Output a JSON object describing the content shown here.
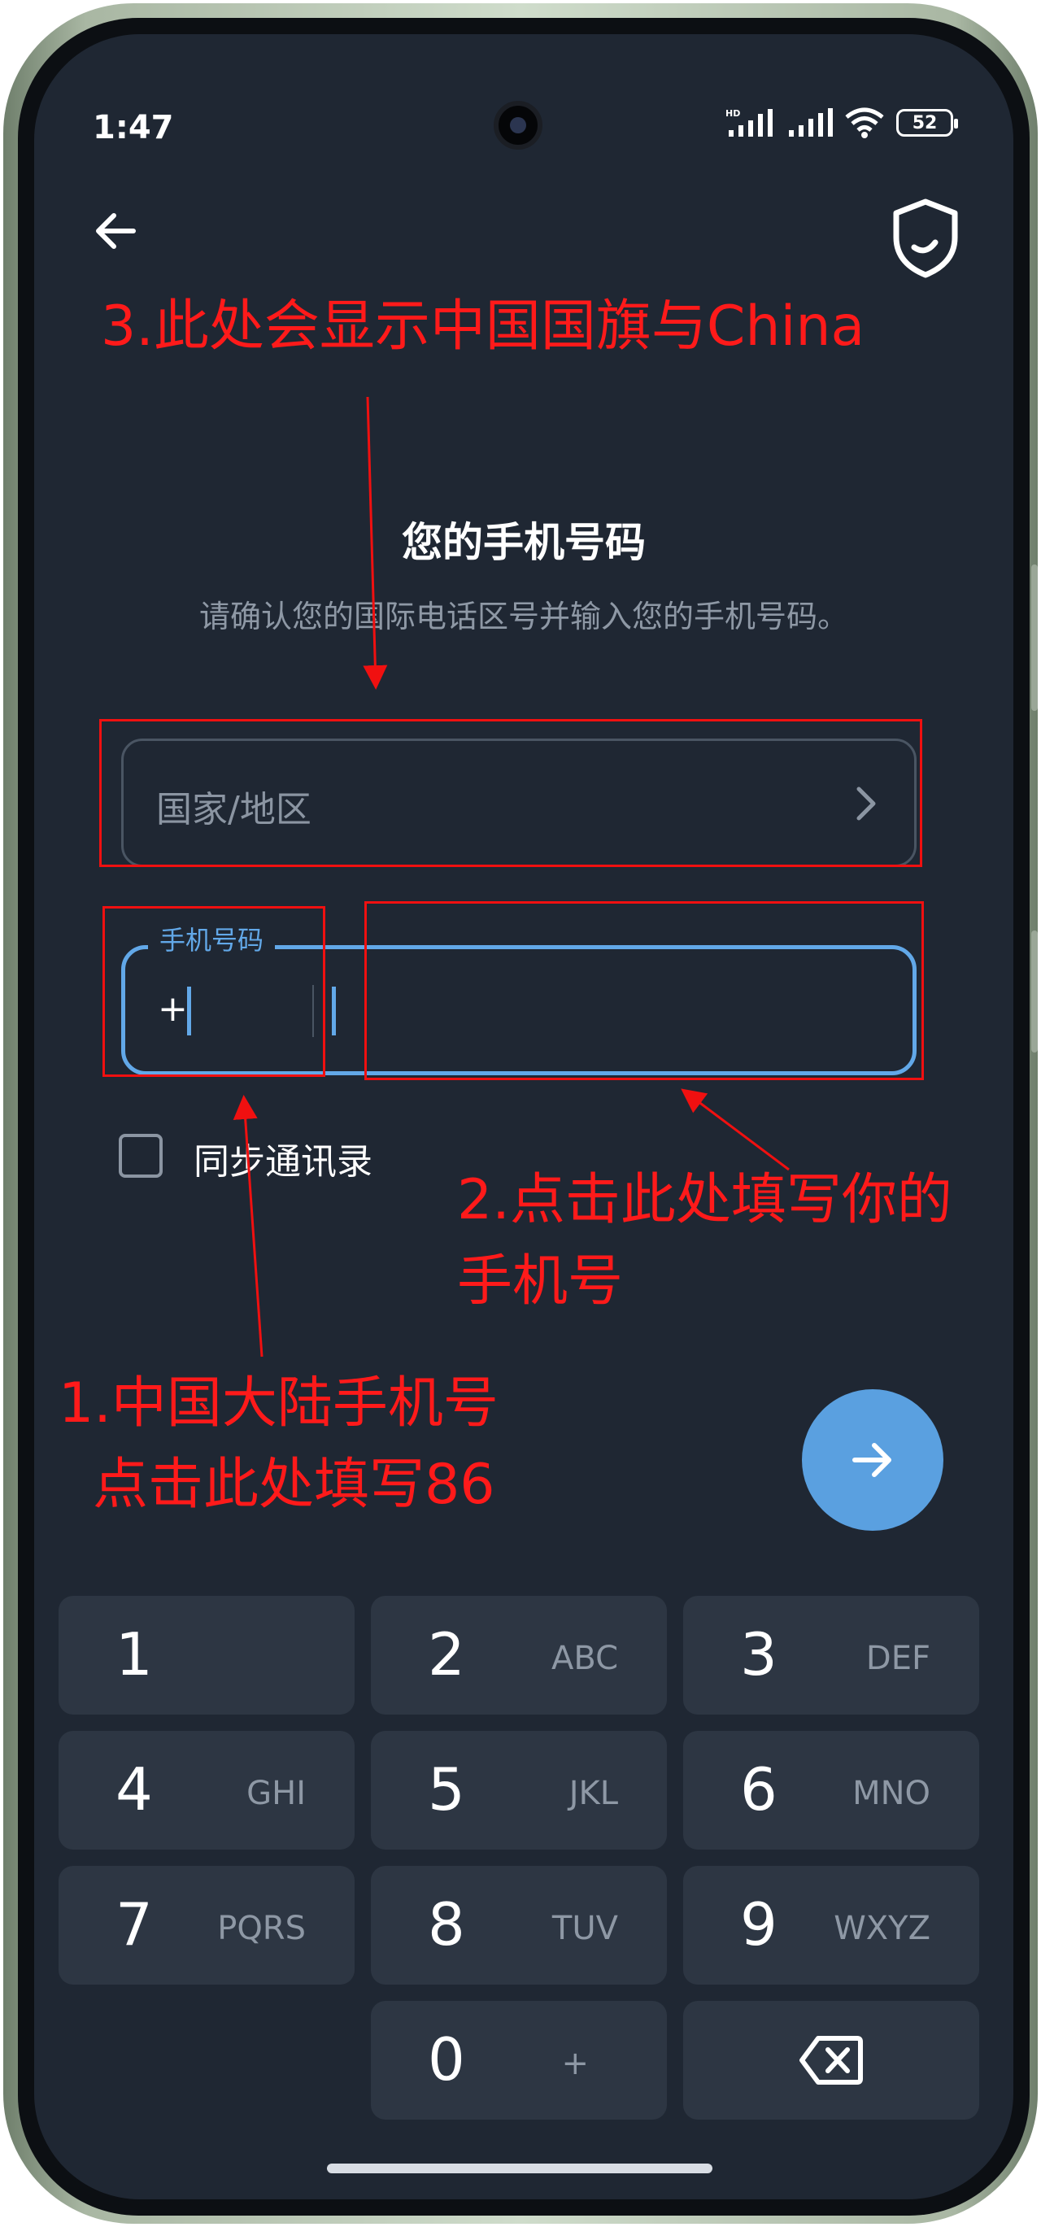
{
  "status_bar": {
    "time": "1:47",
    "network_label": "HD",
    "battery": "52"
  },
  "header": {
    "back_icon": "arrow-left-icon",
    "shield_icon": "shield-icon"
  },
  "main": {
    "title": "您的手机号码",
    "subtitle": "请确认您的国际电话区号并输入您的手机号码。",
    "country_field": {
      "placeholder": "国家/地区"
    },
    "phone_field": {
      "label": "手机号码",
      "code_prefix": "+",
      "code_value": "",
      "number_value": ""
    },
    "sync_contacts": {
      "label": "同步通讯录",
      "checked": false
    }
  },
  "keypad": {
    "keys": [
      {
        "digit": "1",
        "letters": ""
      },
      {
        "digit": "2",
        "letters": "ABC"
      },
      {
        "digit": "3",
        "letters": "DEF"
      },
      {
        "digit": "4",
        "letters": "GHI"
      },
      {
        "digit": "5",
        "letters": "JKL"
      },
      {
        "digit": "6",
        "letters": "MNO"
      },
      {
        "digit": "7",
        "letters": "PQRS"
      },
      {
        "digit": "8",
        "letters": "TUV"
      },
      {
        "digit": "9",
        "letters": "WXYZ"
      },
      {
        "digit": "0",
        "letters": "+"
      }
    ]
  },
  "annotations": {
    "note3": "3.此处会显示中国国旗与China",
    "note2_line1": "2.点击此处填写你的",
    "note2_line2": "手机号",
    "note1_line1": "1.中国大陆手机号",
    "note1_line2": "点击此处填写86"
  },
  "colors": {
    "background": "#1f2733",
    "accent": "#5aa0e0",
    "annotation": "#ff1a1a"
  }
}
